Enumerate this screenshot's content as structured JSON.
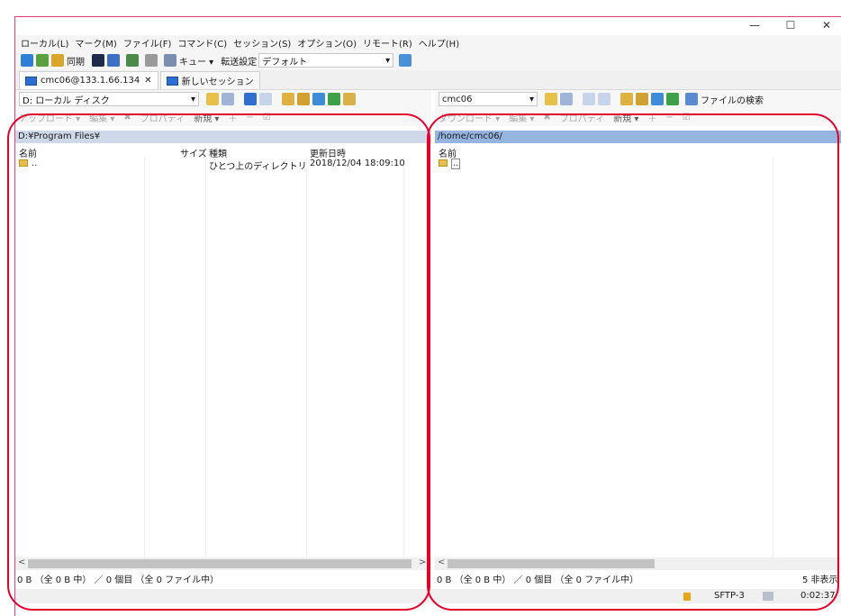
{
  "window": {
    "controls": [
      "—",
      "☐",
      "✕"
    ]
  },
  "menubar": {
    "items": [
      "ローカル(L)",
      "マーク(M)",
      "ファイル(F)",
      "コマンド(C)",
      "セッション(S)",
      "オプション(O)",
      "リモート(R)",
      "ヘルプ(H)"
    ]
  },
  "toolbar": {
    "sync_label": "同期",
    "queue_label": "キュー ▾",
    "transfer_label": "転送設定",
    "transfer_value": "デフォルト"
  },
  "tabs": [
    {
      "label": "cmc06@133.1.66.134",
      "close": "✕"
    },
    {
      "label": "新しいセッション"
    }
  ],
  "left": {
    "drive": "D: ローカル ディスク",
    "actions": [
      "アップロード ▾",
      "編集 ▾",
      "✖",
      "プロパティ",
      "新規 ▾",
      "＋",
      "−",
      "☑"
    ],
    "path": "D:¥Program Files¥",
    "headers": {
      "name": "名前",
      "size": "サイズ",
      "type": "種類",
      "modified": "更新日時"
    },
    "rows": [
      {
        "name": "..",
        "size": "",
        "type": "ひとつ上のディレクトリ",
        "modified": "2018/12/04  18:09:10"
      }
    ],
    "status": "0 B （全 0 B 中） ／ 0 個目 （全 0 ファイル中）"
  },
  "right": {
    "folder": "cmc06",
    "search_label": "ファイルの検索",
    "actions": [
      "ダウンロード ▾",
      "編集 ▾",
      "✖",
      "プロパティ",
      "新規 ▾",
      "＋",
      "−",
      "☑"
    ],
    "path": "/home/cmc06/",
    "headers": {
      "name": "名前"
    },
    "rows": [
      {
        "name": ".."
      }
    ],
    "status": "0 B （全 0 B 中） ／ 0 個目 （全 0 ファイル中）",
    "hidden": "5 非表示"
  },
  "bottom": {
    "protocol": "SFTP-3",
    "time": "0:02:37"
  },
  "colors": {
    "annotation": "#e3002b",
    "window_border": "#e0407a",
    "path_left": "#cfd8e8",
    "path_right": "#96b4e0"
  }
}
